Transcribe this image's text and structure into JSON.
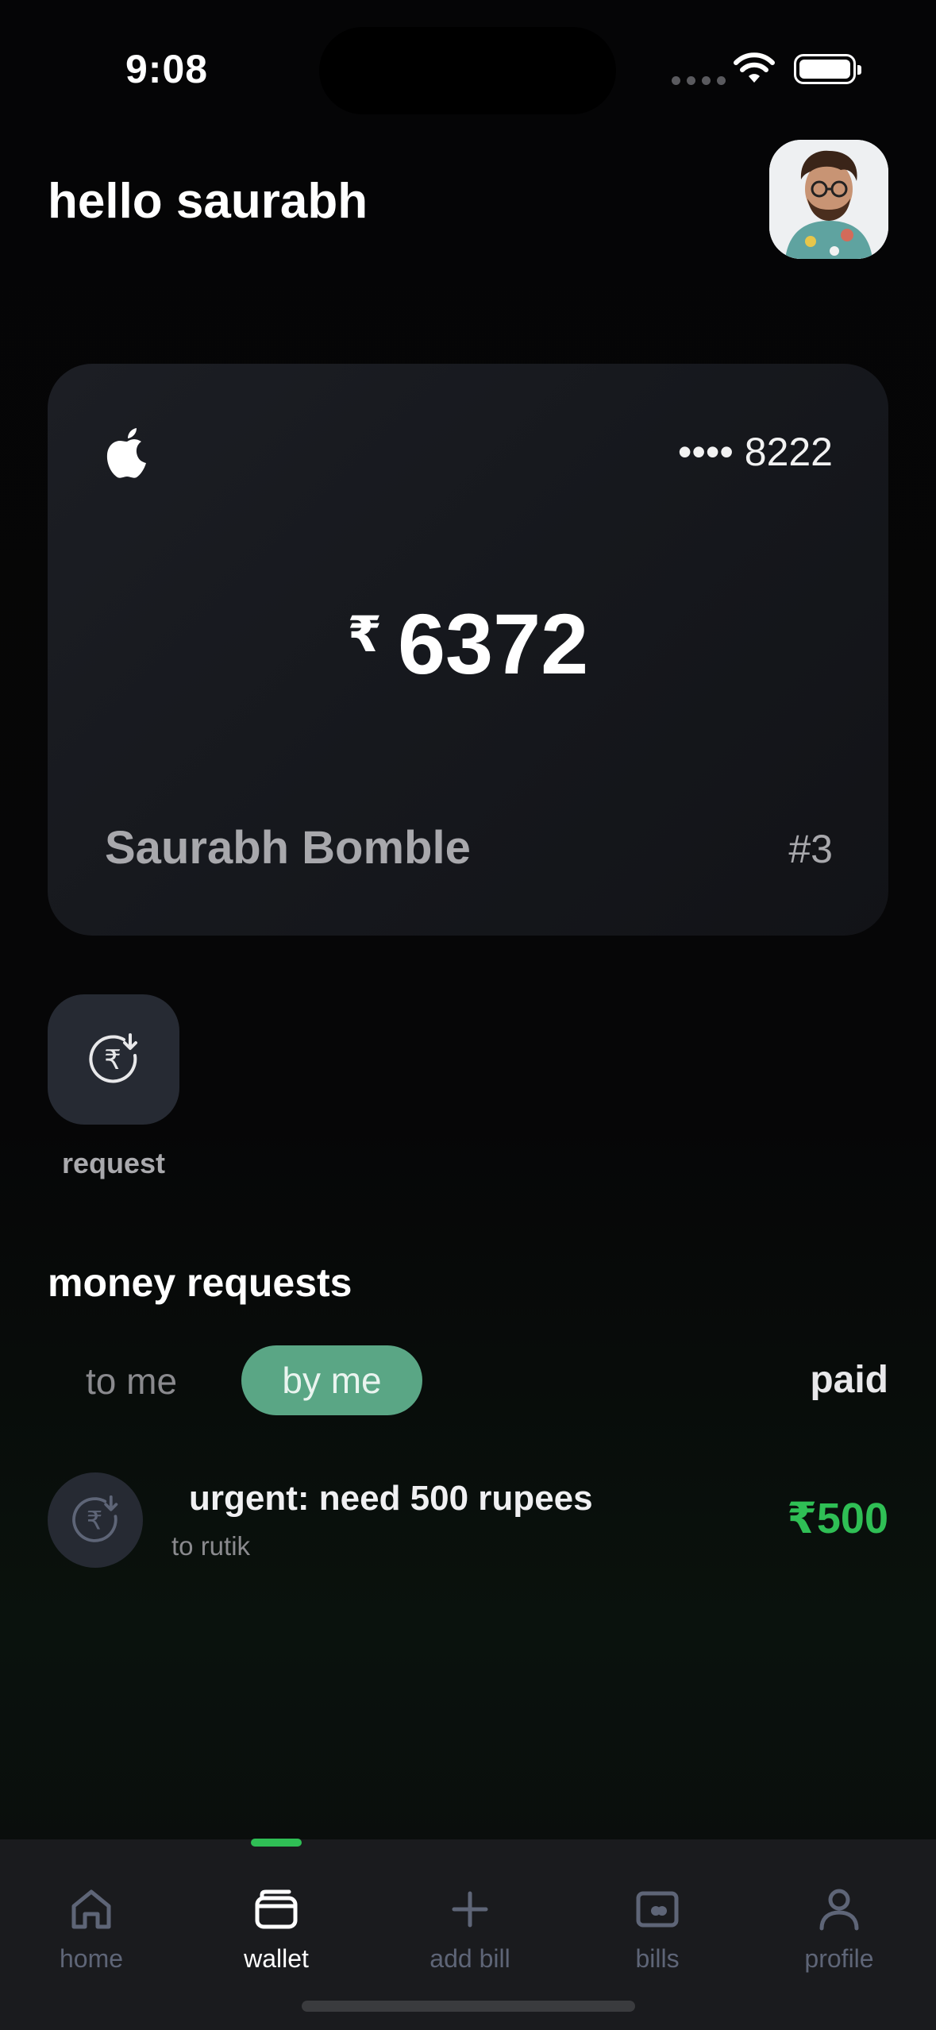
{
  "status_bar": {
    "time": "9:08"
  },
  "header": {
    "greeting": "hello saurabh",
    "avatar_icon": "user-photo"
  },
  "card": {
    "brand_icon": "apple-logo",
    "masked_number": "•••• 8222",
    "currency_symbol": "₹",
    "balance": "6372",
    "holder_name": "Saurabh Bomble",
    "index": "#3"
  },
  "actions": {
    "request_label": "request",
    "request_icon": "rupee-request-icon"
  },
  "money_requests": {
    "title": "money requests",
    "tabs": {
      "to_me": "to me",
      "by_me": "by me",
      "paid": "paid"
    },
    "items": [
      {
        "title": "urgent: need 500 rupees",
        "subtitle": "to rutik",
        "amount": "₹500"
      }
    ]
  },
  "tabbar": {
    "items": [
      {
        "label": "home",
        "icon": "home-icon"
      },
      {
        "label": "wallet",
        "icon": "wallet-icon"
      },
      {
        "label": "add bill",
        "icon": "plus-icon"
      },
      {
        "label": "bills",
        "icon": "bill-icon"
      },
      {
        "label": "profile",
        "icon": "profile-icon"
      }
    ]
  },
  "colors": {
    "accent_green": "#2fbf55",
    "tab_selected": "#5aa685",
    "inactive_icon": "#5e6577"
  }
}
